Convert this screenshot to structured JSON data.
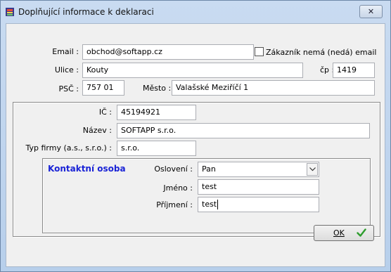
{
  "window": {
    "title": "Doplňující informace k deklaraci",
    "close_icon": "close-icon"
  },
  "form": {
    "email": {
      "label": "Email :",
      "value": "obchod@softapp.cz"
    },
    "no_email_checkbox": {
      "label": "Zákazník nemá (nedá) email",
      "checked": false
    },
    "street": {
      "label": "Ulice :",
      "value": "Kouty"
    },
    "house_number": {
      "label": "čp :",
      "value": "1419"
    },
    "zip": {
      "label": "PSČ :",
      "value": "757 01"
    },
    "city": {
      "label": "Město :",
      "value": "Valašské Meziříčí 1"
    }
  },
  "company": {
    "ic": {
      "label": "IČ :",
      "value": "45194921"
    },
    "name": {
      "label": "Název :",
      "value": "SOFTAPP s.r.o."
    },
    "type": {
      "label": "Typ firmy (a.s., s.r.o.) :",
      "value": "s.r.o."
    }
  },
  "contact": {
    "title": "Kontaktní osoba",
    "salutation": {
      "label": "Oslovení :",
      "value": "Pan"
    },
    "first_name": {
      "label": "Jméno :",
      "value": "test"
    },
    "last_name": {
      "label": "Příjmení :",
      "value": "test"
    }
  },
  "buttons": {
    "ok": "OK"
  },
  "colors": {
    "group_title": "#1a23d6",
    "ok_check": "#2e9d2e",
    "window_frame": "#bcd3ee"
  }
}
